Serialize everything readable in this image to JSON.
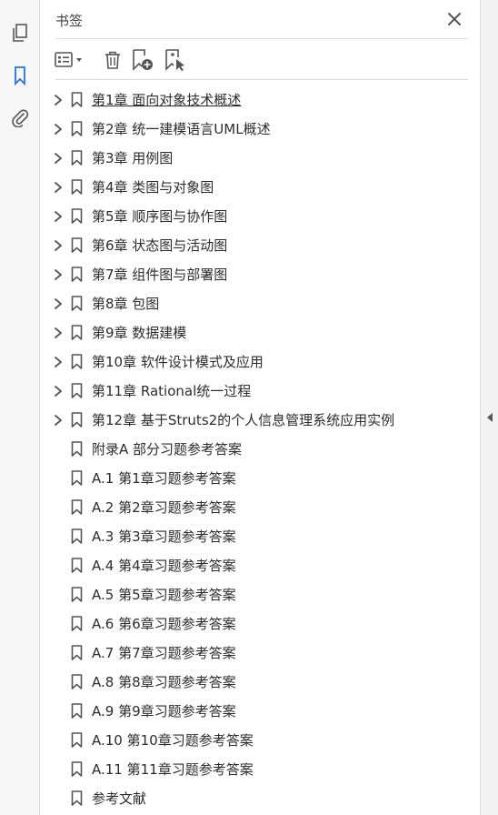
{
  "panel": {
    "title": "书签"
  },
  "bookmarks": [
    {
      "label": "第1章 面向对象技术概述",
      "expandable": true
    },
    {
      "label": "第2章 统一建模语言UML概述",
      "expandable": true
    },
    {
      "label": "第3章 用例图",
      "expandable": true
    },
    {
      "label": "第4章 类图与对象图",
      "expandable": true
    },
    {
      "label": "第5章 顺序图与协作图",
      "expandable": true
    },
    {
      "label": "第6章 状态图与活动图",
      "expandable": true
    },
    {
      "label": "第7章 组件图与部署图",
      "expandable": true
    },
    {
      "label": "第8章 包图",
      "expandable": true
    },
    {
      "label": "第9章 数据建模",
      "expandable": true
    },
    {
      "label": "第10章 软件设计模式及应用",
      "expandable": true
    },
    {
      "label": "第11章 Rational统一过程",
      "expandable": true
    },
    {
      "label": "第12章 基于Struts2的个人信息管理系统应用实例",
      "expandable": true
    },
    {
      "label": "附录A 部分习题参考答案",
      "expandable": false
    },
    {
      "label": "A.1 第1章习题参考答案",
      "expandable": false
    },
    {
      "label": "A.2 第2章习题参考答案",
      "expandable": false
    },
    {
      "label": "A.3 第3章习题参考答案",
      "expandable": false
    },
    {
      "label": "A.4 第4章习题参考答案",
      "expandable": false
    },
    {
      "label": "A.5 第5章习题参考答案",
      "expandable": false
    },
    {
      "label": "A.6 第6章习题参考答案",
      "expandable": false
    },
    {
      "label": "A.7 第7章习题参考答案",
      "expandable": false
    },
    {
      "label": "A.8 第8章习题参考答案",
      "expandable": false
    },
    {
      "label": "A.9 第9章习题参考答案",
      "expandable": false
    },
    {
      "label": "A.10 第10章习题参考答案",
      "expandable": false
    },
    {
      "label": "A.11 第11章习题参考答案",
      "expandable": false
    },
    {
      "label": "参考文献",
      "expandable": false
    }
  ],
  "colors": {
    "accent": "#2a6fdb",
    "icon": "#555555",
    "text": "#2c2c2c"
  },
  "icons": {
    "rail": [
      "pages-icon",
      "bookmark-icon",
      "attachment-icon"
    ],
    "toolbar": [
      "options-menu-icon",
      "delete-icon",
      "new-bookmark-icon",
      "bookmark-from-selection-icon"
    ],
    "close": "close-icon"
  }
}
